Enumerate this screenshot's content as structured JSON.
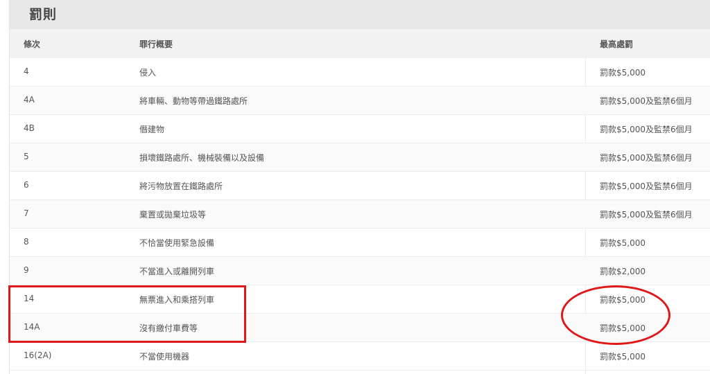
{
  "section": {
    "title": "罰則"
  },
  "table": {
    "headers": {
      "article": "條次",
      "summary": "罪行概要",
      "penalty": "最高處罰"
    },
    "rows": [
      {
        "article": "4",
        "summary": "侵入",
        "penalty": "罰款$5,000"
      },
      {
        "article": "4A",
        "summary": "將車輛、動物等帶過鐵路處所",
        "penalty": "罰款$5,000及監禁6個月"
      },
      {
        "article": "4B",
        "summary": "僭建物",
        "penalty": "罰款$5,000及監禁6個月"
      },
      {
        "article": "5",
        "summary": "損壞鐵路處所、機械裝備以及設備",
        "penalty": "罰款$5,000及監禁6個月"
      },
      {
        "article": "6",
        "summary": "將污物放置在鐵路處所",
        "penalty": "罰款$5,000及監禁6個月"
      },
      {
        "article": "7",
        "summary": "棄置或拋棄垃圾等",
        "penalty": "罰款$5,000及監禁6個月"
      },
      {
        "article": "8",
        "summary": "不恰當使用緊急設備",
        "penalty": "罰款$5,000"
      },
      {
        "article": "9",
        "summary": "不當進入或離開列車",
        "penalty": "罰款$2,000"
      },
      {
        "article": "14",
        "summary": "無票進入和乘搭列車",
        "penalty": "罰款$5,000"
      },
      {
        "article": "14A",
        "summary": "沒有繳付車費等",
        "penalty": "罰款$5,000"
      },
      {
        "article": "16(2A)",
        "summary": "不當使用機器",
        "penalty": "罰款$5,000"
      }
    ]
  },
  "annotations": {
    "color": "#e01818",
    "shapes": [
      "rectangle",
      "ellipse"
    ]
  }
}
